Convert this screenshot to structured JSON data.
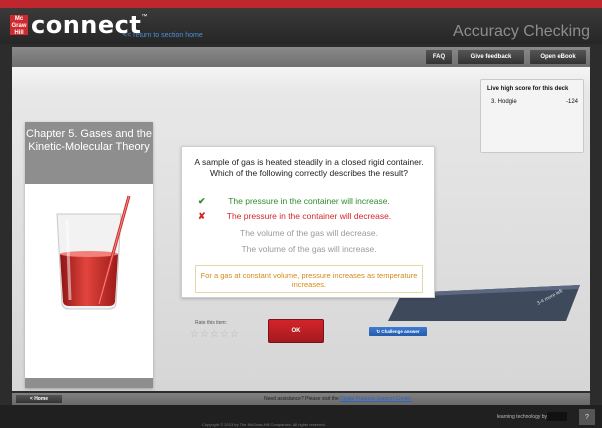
{
  "header": {
    "logo_mark": "Mc Graw Hill",
    "logo_text": "connect",
    "logo_tm": "™",
    "return_link": "<< return to section home",
    "app_title": "Accuracy Checking"
  },
  "toolbar": {
    "faq": "FAQ",
    "feedback": "Give feedback",
    "ebook": "Open eBook"
  },
  "chapter": {
    "title": "Chapter 5. Gases and the Kinetic-Molecular Theory"
  },
  "scoreboard": {
    "title": "Live high score for this deck",
    "rank": "3. Hodgie",
    "score": "-124"
  },
  "deck": {
    "label": "3-4 more left"
  },
  "question": {
    "text": "A sample of gas is heated steadily in a closed rigid container. Which of the following correctly describes the result?",
    "answers": [
      {
        "text": "The pressure in the container will increase.",
        "mark": "✔",
        "color": "#2e8b2e"
      },
      {
        "text": "The pressure in the container will decrease.",
        "mark": "✘",
        "color": "#d3262b"
      },
      {
        "text": "The volume of the gas will decrease.",
        "mark": "",
        "color": "#9a9a9a"
      },
      {
        "text": "The volume of the gas will increase.",
        "mark": "",
        "color": "#9a9a9a"
      }
    ],
    "feedback": "For a gas at constant volume, pressure increases as temperature increases."
  },
  "rating": {
    "label": "Rate this item:",
    "stars": "☆☆☆☆☆"
  },
  "actions": {
    "ok": "OK",
    "challenge": "↻ Challenge answer"
  },
  "footer": {
    "home": "< Home",
    "assist_text": "Need assistance? Please visit the ",
    "assist_link": "Digital Products Support Center.",
    "learning": "learning technology by",
    "corner_icon": "?",
    "copyright": "Copyright © 2013 by The McGraw-Hill Companies. All rights reserved."
  },
  "colors": {
    "brand_red": "#d12a2e",
    "link_blue": "#4d8fd6",
    "feedback_orange": "#d68a15"
  }
}
